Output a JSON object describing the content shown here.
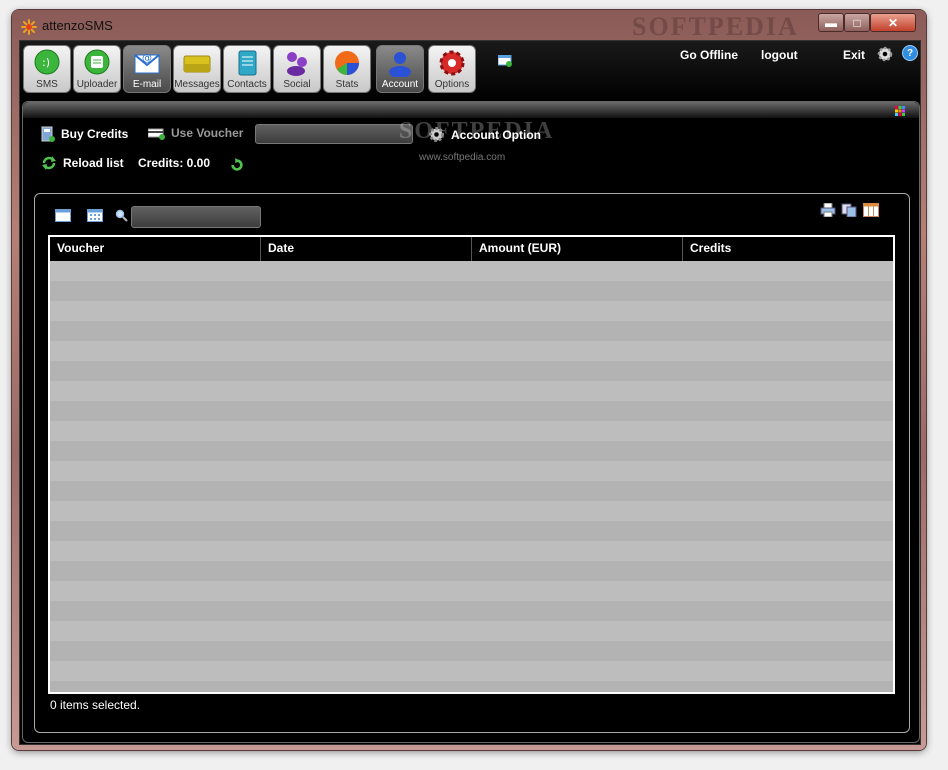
{
  "window": {
    "title": "attenzoSMS",
    "watermark": "SOFTPEDIA",
    "controls": {
      "minimize": "▬",
      "maximize": "□",
      "close": "✕"
    }
  },
  "toolbar": {
    "tabs": [
      {
        "id": "sms",
        "label": "SMS",
        "icon": "sms-bubble-icon",
        "color": "#3cb53c",
        "active": false
      },
      {
        "id": "uploader",
        "label": "Uploader",
        "icon": "uploader-icon",
        "color": "#3cb53c",
        "active": false
      },
      {
        "id": "email",
        "label": "E-mail",
        "icon": "email-envelope-icon",
        "color": "#2a6fd0",
        "active": true
      },
      {
        "id": "messages",
        "label": "Messages",
        "icon": "messages-icon",
        "color": "#d9c21f",
        "active": false
      },
      {
        "id": "contacts",
        "label": "Contacts",
        "icon": "contacts-book-icon",
        "color": "#2fa8c8",
        "active": false
      },
      {
        "id": "social",
        "label": "Social",
        "icon": "social-people-icon",
        "color": "#8a3fc4",
        "active": false
      },
      {
        "id": "stats",
        "label": "Stats",
        "icon": "stats-pie-icon",
        "color": "#f06a1a",
        "active": false
      },
      {
        "id": "account",
        "label": "Account",
        "icon": "account-user-icon",
        "color": "#2b52d6",
        "active": true
      },
      {
        "id": "options",
        "label": "Options",
        "icon": "options-gear-icon",
        "color": "#d92a2a",
        "active": false
      }
    ],
    "links": {
      "go_offline": "Go Offline",
      "logout": "logout",
      "exit": "Exit"
    },
    "help": "?"
  },
  "account": {
    "buy_credits": "Buy Credits",
    "use_voucher": "Use Voucher",
    "voucher_value": "",
    "account_option": "Account Option",
    "reload_list": "Reload list",
    "credits_label": "Credits: 0.00",
    "watermark": "SOFTPEDIA",
    "watermark_url": "www.softpedia.com"
  },
  "list": {
    "search_value": "",
    "columns": [
      "Voucher",
      "Date",
      "Amount (EUR)",
      "Credits"
    ],
    "rows": [],
    "status": "0 items selected."
  }
}
